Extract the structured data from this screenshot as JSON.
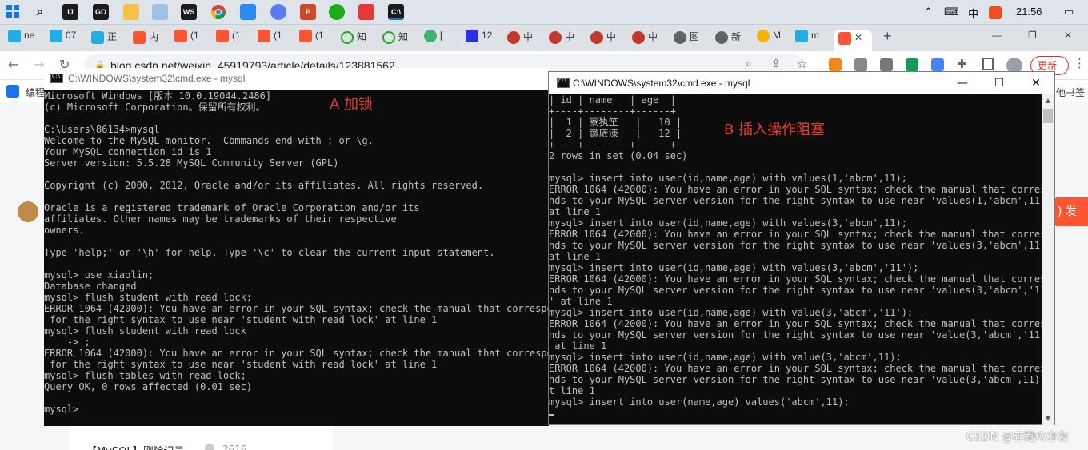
{
  "taskbar": {
    "ime_mode": "中",
    "clock": "21:56"
  },
  "browser": {
    "tabs": [
      {
        "label": "ne"
      },
      {
        "label": "07"
      },
      {
        "label": "正"
      },
      {
        "label": "内"
      },
      {
        "label": "(1"
      },
      {
        "label": "(1"
      },
      {
        "label": "(1"
      },
      {
        "label": "(1"
      },
      {
        "label": "知"
      },
      {
        "label": "知"
      },
      {
        "label": "["
      },
      {
        "label": "12"
      },
      {
        "label": "中"
      },
      {
        "label": "中"
      },
      {
        "label": "中"
      },
      {
        "label": "中"
      },
      {
        "label": "图"
      },
      {
        "label": "新"
      },
      {
        "label": "M"
      },
      {
        "label": "m"
      }
    ],
    "address": "blog.csdn.net/weixin_45919793/article/details/123881562",
    "update_button": "更新",
    "bookmark_left": "编程",
    "bookmark_right": "他书签"
  },
  "page": {
    "side_button": ") 发",
    "article_link": "【MySQL】删除记录",
    "article_views": "2616"
  },
  "window_a": {
    "title": "C:\\WINDOWS\\system32\\cmd.exe - mysql",
    "annotation": "A 加锁",
    "lines": [
      "Microsoft Windows [版本 10.0.19044.2486]",
      "(c) Microsoft Corporation。保留所有权利。",
      "",
      "C:\\Users\\86134>mysql",
      "Welcome to the MySQL monitor.  Commands end with ; or \\g.",
      "Your MySQL connection id is 1",
      "Server version: 5.5.28 MySQL Community Server (GPL)",
      "",
      "Copyright (c) 2000, 2012, Oracle and/or its affiliates. All rights reserved.",
      "",
      "Oracle is a registered trademark of Oracle Corporation and/or its",
      "affiliates. Other names may be trademarks of their respective",
      "owners.",
      "",
      "Type 'help;' or '\\h' for help. Type '\\c' to clear the current input statement.",
      "",
      "mysql> use xiaolin;",
      "Database changed",
      "mysql> flush student with read lock;",
      "ERROR 1064 (42000): You have an error in your SQL syntax; check the manual that correspond",
      " for the right syntax to use near 'student with read lock' at line 1",
      "mysql> flush student with read lock",
      "    -> ;",
      "ERROR 1064 (42000): You have an error in your SQL syntax; check the manual that correspond",
      " for the right syntax to use near 'student with read lock' at line 1",
      "mysql> flush tables with read lock;",
      "Query OK, 0 rows affected (0.01 sec)",
      "",
      "mysql>"
    ]
  },
  "window_b": {
    "title": "C:\\WINDOWS\\system32\\cmd.exe - mysql",
    "annotation": "B 插入操作阻塞",
    "buttons": {
      "minimize": "—",
      "maximize": "☐",
      "close": "✕"
    },
    "lines": [
      "| id | name   | age  |",
      "+----+--------+------+",
      "|  1 | 寮犱笁   |   10 |",
      "|  2 | 鏉庡洓   |   12 |",
      "+----+--------+------+",
      "2 rows in set (0.04 sec)",
      "",
      "mysql> insert into user(id,name,age) with values(1,'abcm',11);",
      "ERROR 1064 (42000): You have an error in your SQL syntax; check the manual that correspo",
      "nds to your MySQL server version for the right syntax to use near 'values(1,'abcm',11)'",
      "at line 1",
      "mysql> insert into user(id,name,age) with values(3,'abcm',11);",
      "ERROR 1064 (42000): You have an error in your SQL syntax; check the manual that correspo",
      "nds to your MySQL server version for the right syntax to use near 'values(3,'abcm',11)'",
      "at line 1",
      "mysql> insert into user(id,name,age) with values(3,'abcm','11');",
      "ERROR 1064 (42000): You have an error in your SQL syntax; check the manual that correspo",
      "nds to your MySQL server version for the right syntax to use near 'values(3,'abcm','11')",
      "' at line 1",
      "mysql> insert into user(id,name,age) with value(3,'abcm','11');",
      "ERROR 1064 (42000): You have an error in your SQL syntax; check the manual that correspo",
      "nds to your MySQL server version for the right syntax to use near 'value(3,'abcm','11')'",
      " at line 1",
      "mysql> insert into user(id,name,age) with value(3,'abcm',11);",
      "ERROR 1064 (42000): You have an error in your SQL syntax; check the manual that correspo",
      "nds to your MySQL server version for the right syntax to use near 'value(3,'abcm',11)' a",
      "t line 1",
      "mysql> insert into user(name,age) values('abcm',11);"
    ]
  },
  "watermark": "CSDN @奔跑の亦友",
  "colors": {
    "console_bg": "#0c0c0c",
    "console_fg": "#c0c0c0",
    "annotation": "#e63c2c",
    "taskbar": "#dfe3ea",
    "update_button": "#d93025"
  }
}
